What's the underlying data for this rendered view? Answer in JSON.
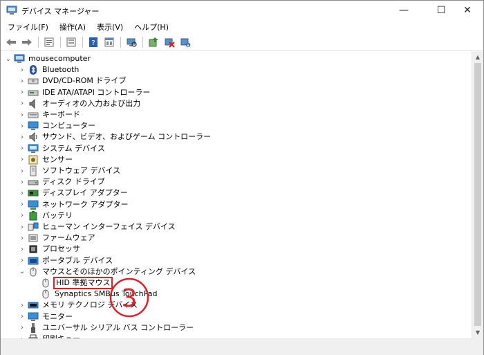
{
  "window": {
    "title": "デバイス マネージャー",
    "controls": {
      "minimize": "—",
      "maximize": "☐",
      "close": "✕"
    }
  },
  "menu": [
    "ファイル(F)",
    "操作(A)",
    "表示(V)",
    "ヘルプ(H)"
  ],
  "toolbar": [
    "back-icon",
    "forward-icon",
    "properties-icon",
    "view-icon",
    "help-icon",
    "update-view-icon",
    "scan-hardware-icon",
    "update-driver-icon",
    "uninstall-device-icon",
    "download-icon"
  ],
  "tree": {
    "root": "mousecomputer",
    "nodes": [
      {
        "label": "Bluetooth",
        "icon": "bluetooth-icon",
        "expanded": false
      },
      {
        "label": "DVD/CD-ROM ドライブ",
        "icon": "dvd-drive-icon",
        "expanded": false
      },
      {
        "label": "IDE ATA/ATAPI コントローラー",
        "icon": "ide-controller-icon",
        "expanded": false
      },
      {
        "label": "オーディオの入力および出力",
        "icon": "audio-icon",
        "expanded": false
      },
      {
        "label": "キーボード",
        "icon": "keyboard-icon",
        "expanded": false
      },
      {
        "label": "コンピューター",
        "icon": "computer-icon",
        "expanded": false
      },
      {
        "label": "サウンド、ビデオ、およびゲーム コントローラー",
        "icon": "sound-icon",
        "expanded": false
      },
      {
        "label": "システム デバイス",
        "icon": "system-device-icon",
        "expanded": false
      },
      {
        "label": "センサー",
        "icon": "sensor-icon",
        "expanded": false
      },
      {
        "label": "ソフトウェア デバイス",
        "icon": "software-device-icon",
        "expanded": false
      },
      {
        "label": "ディスク ドライブ",
        "icon": "disk-drive-icon",
        "expanded": false
      },
      {
        "label": "ディスプレイ アダプター",
        "icon": "display-adapter-icon",
        "expanded": false
      },
      {
        "label": "ネットワーク アダプター",
        "icon": "network-adapter-icon",
        "expanded": false
      },
      {
        "label": "バッテリ",
        "icon": "battery-icon",
        "expanded": false
      },
      {
        "label": "ヒューマン インターフェイス デバイス",
        "icon": "hid-icon",
        "expanded": false
      },
      {
        "label": "ファームウェア",
        "icon": "firmware-icon",
        "expanded": false
      },
      {
        "label": "プロセッサ",
        "icon": "processor-icon",
        "expanded": false
      },
      {
        "label": "ポータブル デバイス",
        "icon": "portable-device-icon",
        "expanded": false
      },
      {
        "label": "マウスとそのほかのポインティング デバイス",
        "icon": "mouse-icon",
        "expanded": true,
        "children": [
          {
            "label": "HID 準拠マウス",
            "icon": "mouse-icon",
            "highlighted": true
          },
          {
            "label": "Synaptics SMBus TouchPad",
            "icon": "mouse-icon"
          }
        ]
      },
      {
        "label": "メモリ テクノロジ デバイス",
        "icon": "memory-device-icon",
        "expanded": false
      },
      {
        "label": "モニター",
        "icon": "monitor-icon",
        "expanded": false
      },
      {
        "label": "ユニバーサル シリアル バス コントローラー",
        "icon": "usb-icon",
        "expanded": false
      },
      {
        "label": "印刷キュー",
        "icon": "print-queue-icon",
        "expanded": false
      }
    ]
  },
  "annotation": {
    "step": "3",
    "color": "#e0202a"
  },
  "colors": {
    "highlight_border": "#e02020",
    "scroll_bg": "#f0f0f0"
  }
}
